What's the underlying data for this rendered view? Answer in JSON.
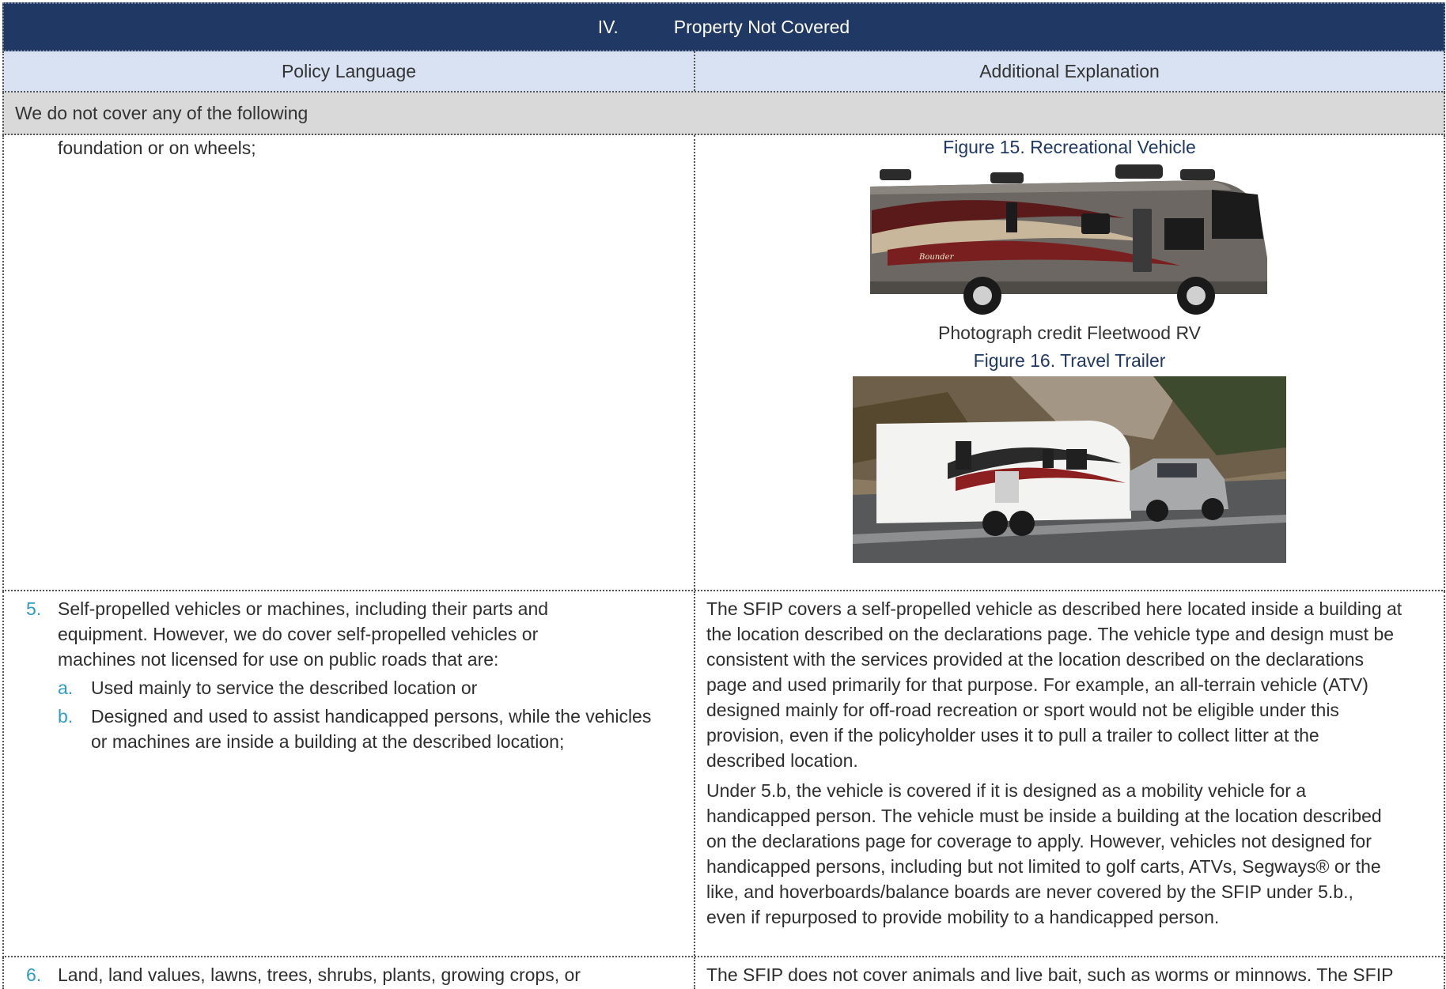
{
  "section": {
    "number": "IV.",
    "title": "Property Not Covered"
  },
  "columns": {
    "left": "Policy Language",
    "right": "Additional Explanation"
  },
  "intro": "We do not cover any of the following",
  "row1": {
    "left_text": "foundation or on wheels;",
    "figure15_title": "Figure 15. Recreational Vehicle",
    "figure15_credit": "Photograph credit Fleetwood RV",
    "figure16_title": "Figure 16. Travel Trailer",
    "rv_brand": "Bounder"
  },
  "row2": {
    "item5": {
      "marker": "5.",
      "line1": "Self-propelled vehicles or machines, including their parts and",
      "line2": "equipment. However, we do cover self-propelled vehicles or",
      "line3": "machines not licensed for use on public roads that are:",
      "a_marker": "a.",
      "a_text": "Used mainly to service the described location or",
      "b_marker": "b.",
      "b_line1": "Designed and used to assist handicapped persons, while the vehicles",
      "b_line2": "or machines are inside a building at the described location;"
    },
    "explanation_p1": [
      "The SFIP covers a self-propelled vehicle as described here located inside a building at",
      "the location described on the declarations page. The vehicle type and design must be",
      "consistent with the services provided at the location described on the declarations",
      "page and used primarily for that purpose. For example, an all-terrain vehicle (ATV)",
      "designed mainly for off-road recreation or sport would not be eligible under this",
      "provision, even if the policyholder uses it to pull a trailer to collect litter at the",
      "described location."
    ],
    "explanation_p2": [
      "Under 5.b, the vehicle is covered if it is designed as a mobility vehicle for a",
      "handicapped person. The vehicle must be inside a building at the location described",
      "on the declarations page for coverage to apply. However, vehicles not designed for",
      "handicapped persons, including but not limited to golf carts, ATVs, Segways® or the",
      "like, and hoverboards/balance boards are never covered by the SFIP under 5.b.,",
      "even if repurposed to provide mobility to a handicapped person."
    ]
  },
  "row3": {
    "marker": "6.",
    "left_text": "Land, land values, lawns, trees, shrubs, plants, growing crops, or",
    "right_text": "The SFIP does not cover animals and live bait, such as worms or minnows. The SFIP"
  }
}
